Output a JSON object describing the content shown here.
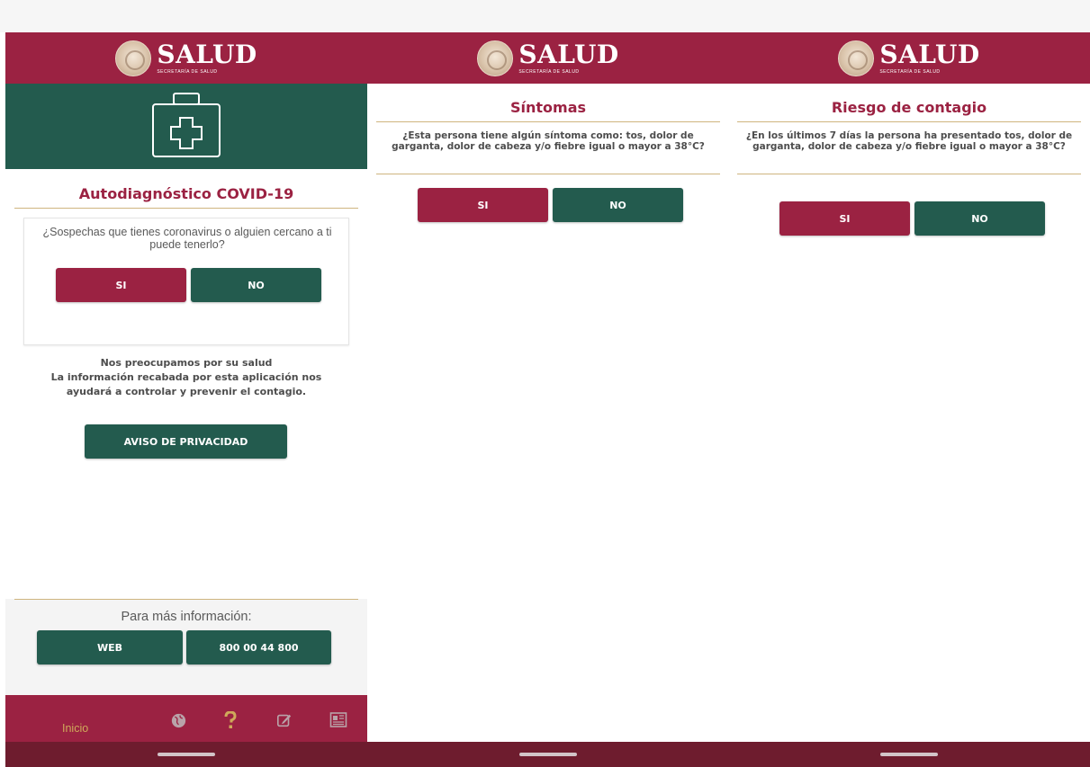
{
  "brand": {
    "title": "SALUD",
    "subtitle": "SECRETARÍA DE SALUD"
  },
  "screen1": {
    "title": "Autodiagnóstico COVID-19",
    "question": "¿Sospechas que tienes coronavirus o alguien cercano a ti puede tenerlo?",
    "yes": "SI",
    "no": "NO",
    "info_line1": "Nos preocupamos por su salud",
    "info_line2": "La información recabada por esta aplicación nos ayudará a controlar y prevenir el contagio.",
    "privacy_button": "AVISO DE PRIVACIDAD",
    "more_info_label": "Para más información:",
    "web_button": "WEB",
    "phone_button": "800 00 44 800",
    "tabs": {
      "home": "Inicio"
    },
    "icons": [
      "globe-icon",
      "question-icon",
      "edit-icon",
      "news-icon"
    ]
  },
  "screen2": {
    "title": "Síntomas",
    "question": "¿Esta persona tiene algún síntoma como: tos, dolor de garganta, dolor de cabeza y/o fiebre igual o mayor a 38°C?",
    "yes": "SI",
    "no": "NO"
  },
  "screen3": {
    "title": "Riesgo de contagio",
    "question": "¿En los últimos 7 días la persona ha presentado tos, dolor de garganta, dolor de cabeza y/o fiebre igual o mayor a 38°C?",
    "yes": "SI",
    "no": "NO"
  },
  "colors": {
    "guinda": "#9b2242",
    "verde": "#235b4e",
    "dorado": "#cfb57f",
    "nav": "#6e1c2e"
  }
}
